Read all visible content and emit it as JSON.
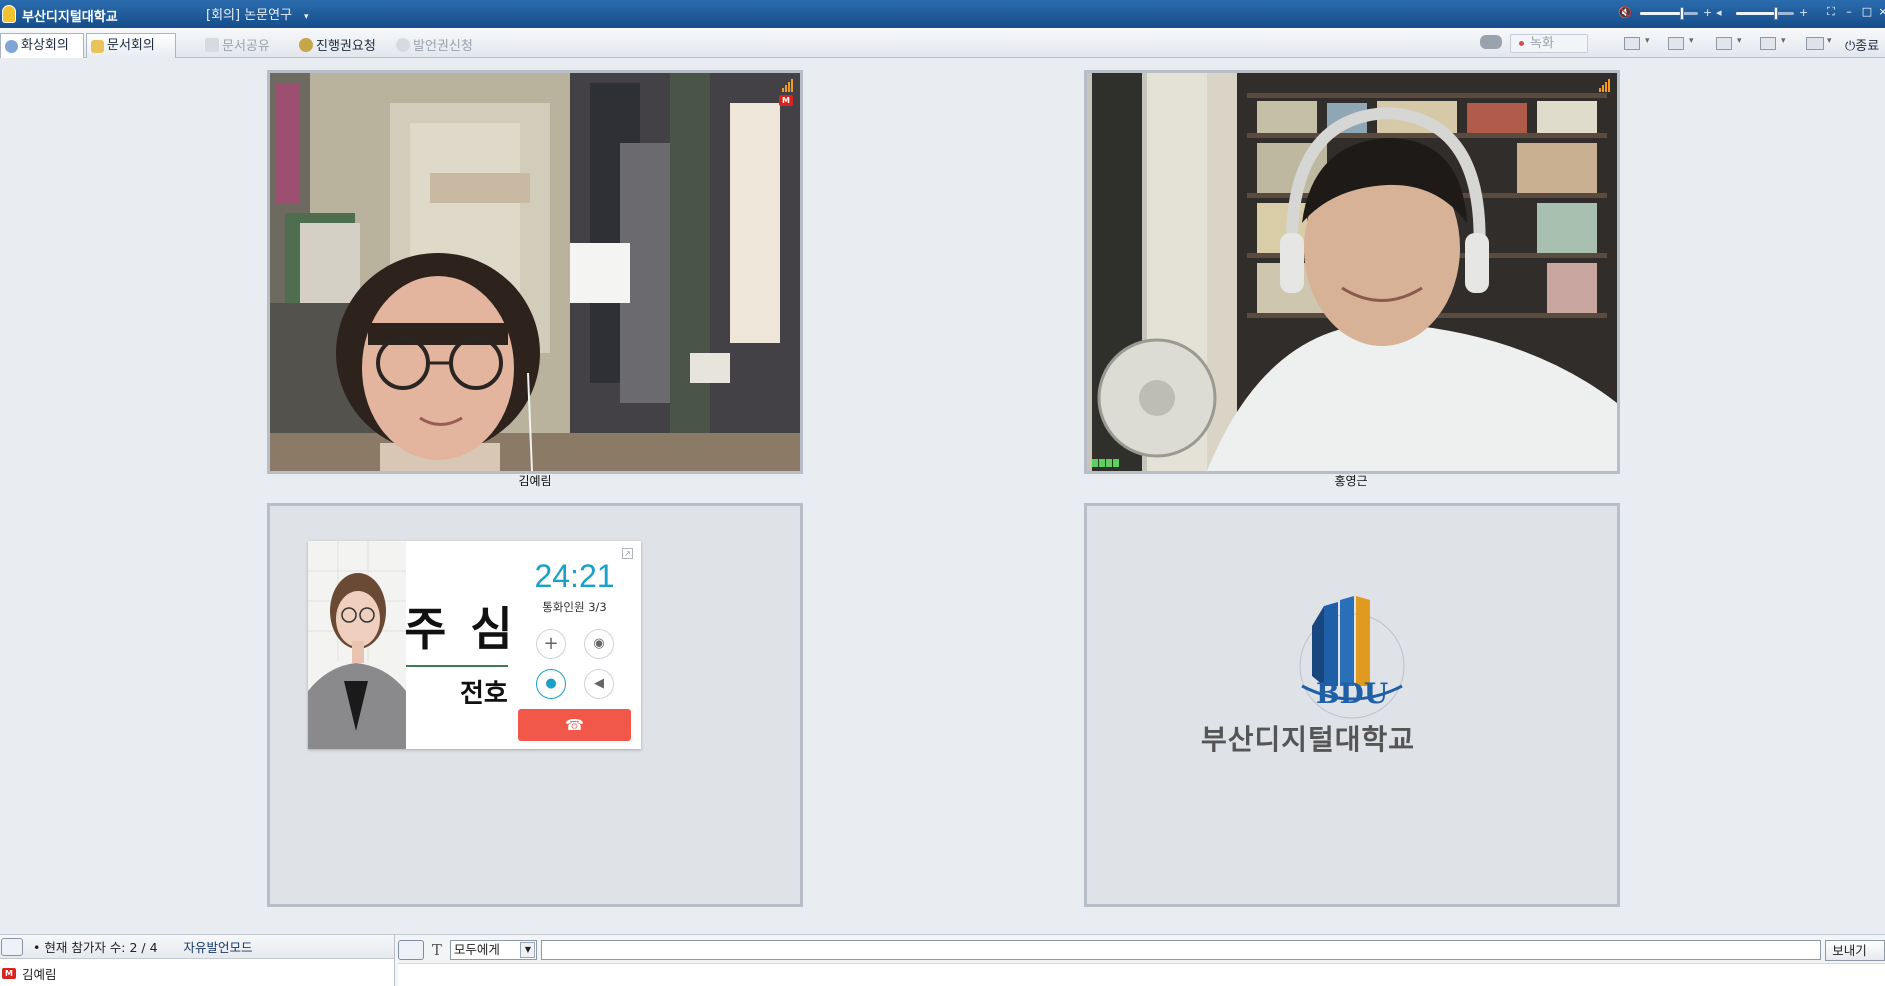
{
  "titlebar": {
    "app_title": "부산디지털대학교",
    "meeting_name": "[회의] 논문연구",
    "meeting_caret": "▾"
  },
  "tabs": [
    {
      "label": "화상회의",
      "active": true
    },
    {
      "label": "문서회의",
      "active": false
    }
  ],
  "toolbar": {
    "share_doc": "문서공유",
    "request_control": "진행권요청",
    "request_speak": "발언권신청",
    "record": "녹화",
    "exit": "종료"
  },
  "participants_video": [
    {
      "name": "김예림"
    },
    {
      "name": "홍영근"
    }
  ],
  "call_overlay": {
    "timer": "24:21",
    "members": "통화인원 3/3",
    "big_text": "주 심",
    "small_text": "전호"
  },
  "bdu": {
    "logo_text": "BDU",
    "ring_text": "BUSAN DIGITAL UNIVERSITY",
    "name": "부산디지털대학교"
  },
  "bottom": {
    "count_text": "• 현재 참가자 수: 2 / 4",
    "mode": "자유발언모드",
    "participant": "김예림",
    "recipient": "모두에게",
    "send": "보내기",
    "chat_value": ""
  },
  "colors": {
    "titlebar": "#1e5a9a",
    "accent_timer": "#1aa0c9",
    "hangup": "#f1584a"
  }
}
